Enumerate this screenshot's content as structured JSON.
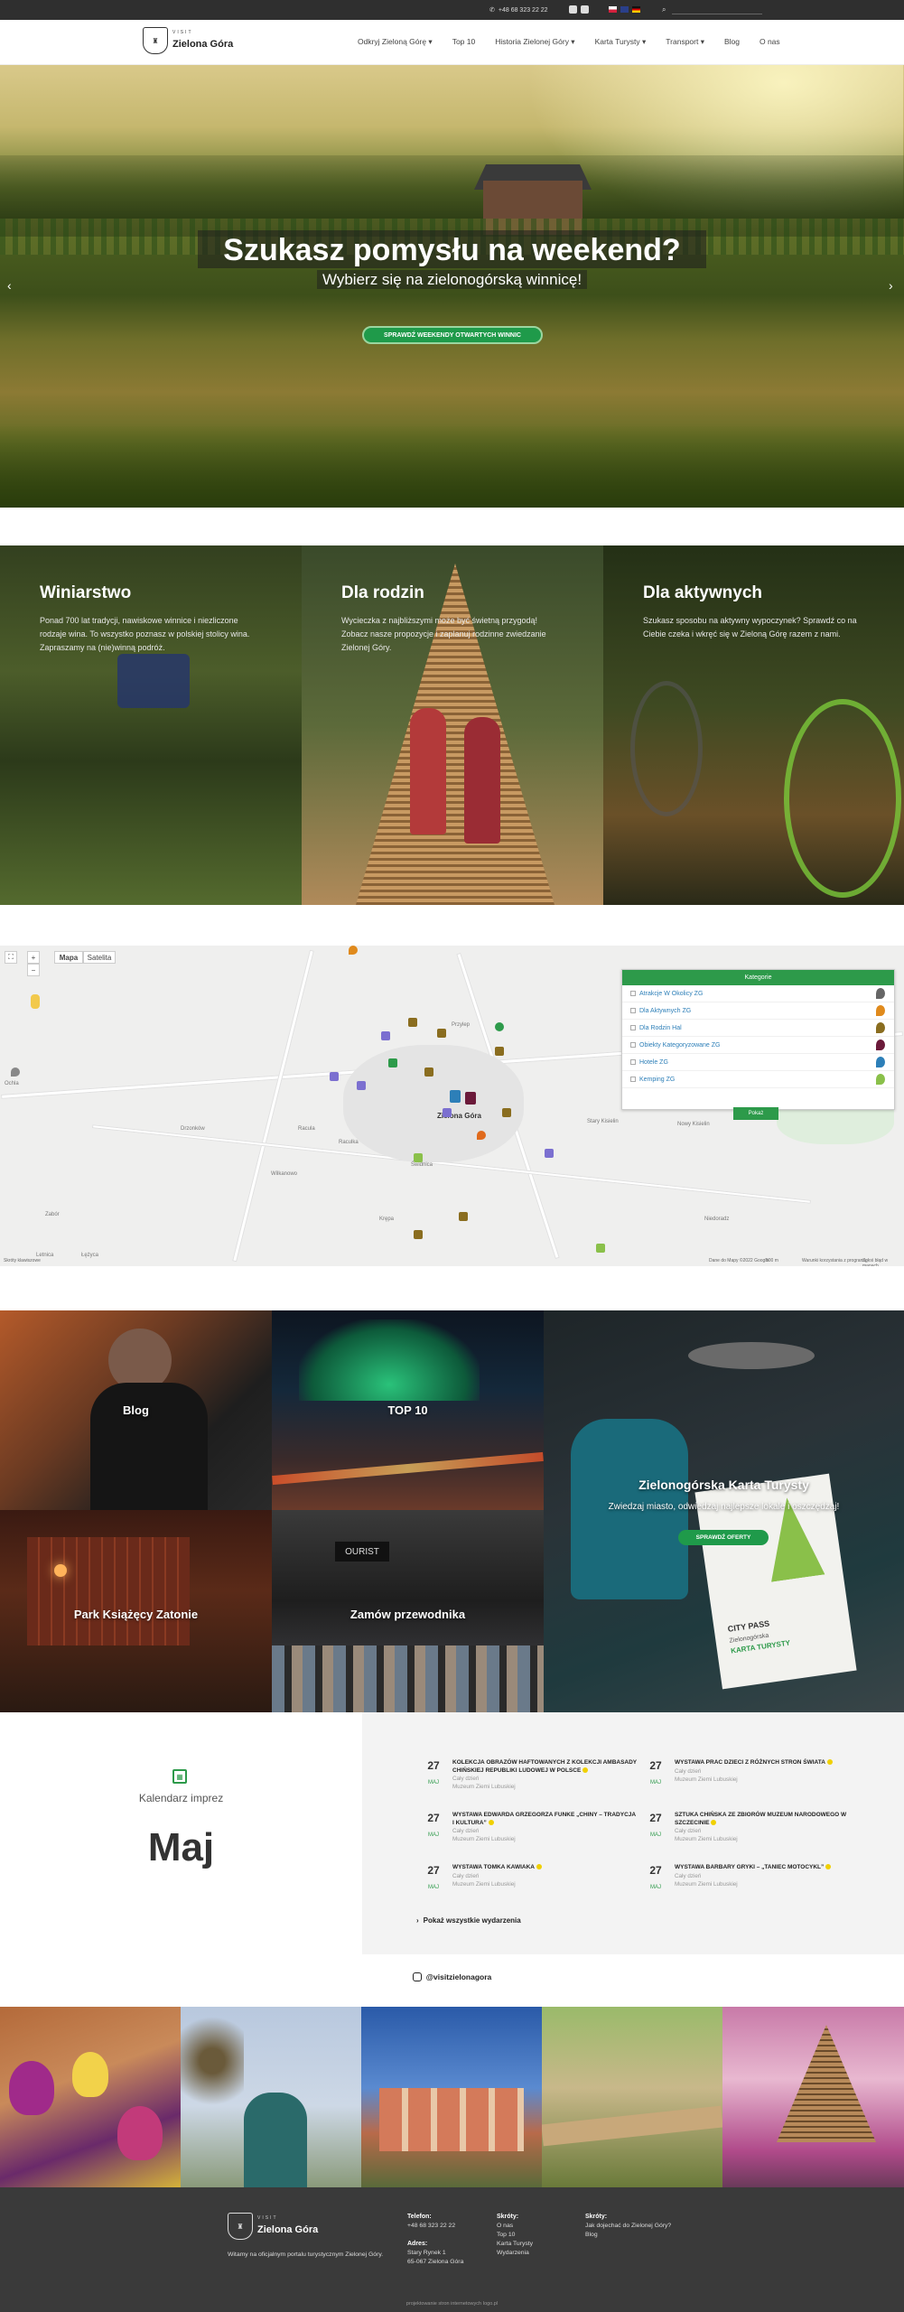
{
  "topbar": {
    "phone": "+48 68 323 22 22"
  },
  "nav": {
    "logo_small": "VISIT",
    "logo_big": "Zielona Góra",
    "links": [
      "Odkryj Zieloną Górę ▾",
      "Top 10",
      "Historia Zielonej Góry ▾",
      "Karta Turysty ▾",
      "Transport ▾",
      "Blog",
      "O nas"
    ]
  },
  "hero": {
    "title": "Szukasz pomysłu na weekend?",
    "subtitle": "Wybierz się na zielonogórską winnicę!",
    "cta": "SPRAWDŹ WEEKENDY OTWARTYCH WINNIC"
  },
  "cards": [
    {
      "title": "Winiarstwo",
      "text": "Ponad 700 lat tradycji, nawiskowe winnice i niezliczone rodzaje wina. To wszystko poznasz w polskiej stolicy wina. Zapraszamy na (nie)winną podróż."
    },
    {
      "title": "Dla rodzin",
      "text": "Wycieczka z najbliższymi może być świetną przygodą! Zobacz nasze propozycje i zaplanuj rodzinne zwiedzanie Zielonej Góry."
    },
    {
      "title": "Dla aktywnych",
      "text": "Szukasz sposobu na aktywny wypoczynek? Sprawdź co na Ciebie czeka i wkręć się w Zieloną Górę razem z nami."
    }
  ],
  "map": {
    "tab_map": "Mapa",
    "tab_sat": "Satelita",
    "city": "Zielona Góra",
    "places": [
      "Przylep",
      "Racula",
      "Raculka",
      "Ochla",
      "Drzonków",
      "Świdnica",
      "Nowy Kisielin",
      "Stary Kisielin",
      "Wilkanowo",
      "Krępa",
      "Łężyca",
      "Zabór",
      "Niedoradz",
      "Letnica"
    ],
    "footer": [
      "Skróty klawiszowe",
      "Dane do Mapy ©2022 Google",
      "500 m",
      "Warunki korzystania z programu",
      "Zgłoś błąd w mapach"
    ],
    "categories_title": "Kategorie",
    "categories": [
      "Atrakcje W Okolicy ZG",
      "Dla Aktywnych ZG",
      "Dla Rodzin Hal",
      "Obiekty Kategoryzowane ZG",
      "Hotele ZG",
      "Kemping ZG"
    ],
    "category_colors": [
      "#666666",
      "#e08a1c",
      "#8a6d1f",
      "#6b1a3a",
      "#2d7fb8",
      "#8ac04a"
    ],
    "find": "Pokaż"
  },
  "tiles": {
    "blog": "Blog",
    "top10": "TOP 10",
    "park": "Park Książęcy Zatonie",
    "guide": "Zamów przewodnika",
    "card_title": "Zielonogórska Karta Turysty",
    "card_sub": "Zwiedzaj miasto, odwiedzaj najlepsze lokale i oszczędzaj!",
    "card_cta": "SPRAWDŹ OFERTY",
    "card_photo": [
      "CITY PASS",
      "Zielonogórska",
      "KARTA TURYSTY"
    ]
  },
  "calendar": {
    "label": "Kalendarz imprez",
    "month": "Maj",
    "all": "Pokaż wszystkie wydarzenia",
    "events": [
      {
        "day": "27",
        "mon": "MAJ",
        "title": "KOLEKCJA OBRAZÓW HAFTOWANYCH Z KOLEKCJI AMBASADY CHIŃSKIEJ REPUBLIKI LUDOWEJ W POLSCE",
        "when": "Cały dzień",
        "where": "Muzeum Ziemi Lubuskiej"
      },
      {
        "day": "27",
        "mon": "MAJ",
        "title": "WYSTAWA PRAC DZIECI Z RÓŻNYCH STRON ŚWIATA",
        "when": "Cały dzień",
        "where": "Muzeum Ziemi Lubuskiej"
      },
      {
        "day": "27",
        "mon": "MAJ",
        "title": "WYSTAWA EDWARDA GRZEGORZA FUNKE „CHINY – TRADYCJA I KULTURA”",
        "when": "Cały dzień",
        "where": "Muzeum Ziemi Lubuskiej"
      },
      {
        "day": "27",
        "mon": "MAJ",
        "title": "SZTUKA CHIŃSKA ZE ZBIORÓW MUZEUM NARODOWEGO W SZCZECINIE",
        "when": "Cały dzień",
        "where": "Muzeum Ziemi Lubuskiej"
      },
      {
        "day": "27",
        "mon": "MAJ",
        "title": "WYSTAWA TOMKA KAWIAKA",
        "when": "Cały dzień",
        "where": "Muzeum Ziemi Lubuskiej"
      },
      {
        "day": "27",
        "mon": "MAJ",
        "title": "WYSTAWA BARBARY GRYKI – „TANIEC MOTOCYKL”",
        "when": "Cały dzień",
        "where": "Muzeum Ziemi Lubuskiej"
      }
    ]
  },
  "instagram": {
    "handle": "@visitzielonagora"
  },
  "footer": {
    "tagline": "Witamy na oficjalnym portalu turystycznym Zielonej Góry.",
    "phone_label": "Telefon:",
    "phone": "+48 68 323 22 22",
    "addr_label": "Adres:",
    "addr1": "Stary Rynek 1",
    "addr2": "65-067 Zielona Góra",
    "col2_label": "Skróty:",
    "col2": [
      "O nas",
      "Top 10",
      "Karta Turysty",
      "Wydarzenia"
    ],
    "col3_label": "Skróty:",
    "col3": [
      "Jak dojechać do Zielonej Góry?",
      "Blog"
    ],
    "credit": "projektowanie stron internetowych Iogo.pl"
  }
}
